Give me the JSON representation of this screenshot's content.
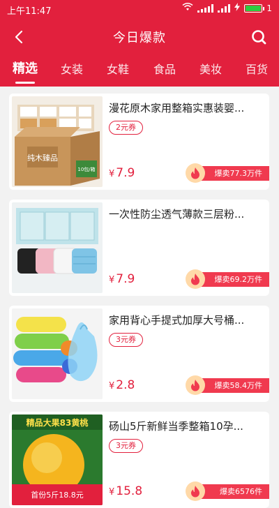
{
  "status_bar": {
    "time": "上午11:47",
    "battery_level": "1"
  },
  "header": {
    "title": "今日爆款"
  },
  "tabs": [
    {
      "label": "精选",
      "active": true
    },
    {
      "label": "女装",
      "active": false
    },
    {
      "label": "女鞋",
      "active": false
    },
    {
      "label": "食品",
      "active": false
    },
    {
      "label": "美妆",
      "active": false
    },
    {
      "label": "百货",
      "active": false
    }
  ],
  "products": [
    {
      "name": "漫花原木家用整箱实惠装婴...",
      "coupon": "2元券",
      "currency": "¥",
      "price": "7.9",
      "sold": "爆卖77.3万件",
      "image": "tissue-box-image",
      "image_text": "纯木臻品",
      "image_badge": "10包/箱"
    },
    {
      "name": "一次性防尘透气薄款三层粉...",
      "coupon": "",
      "currency": "¥",
      "price": "7.9",
      "sold": "爆卖69.2万件",
      "image": "face-masks-image"
    },
    {
      "name": "家用背心手提式加厚大号桶...",
      "coupon": "3元券",
      "currency": "¥",
      "price": "2.8",
      "sold": "爆卖58.4万件",
      "image": "garbage-bags-image"
    },
    {
      "name": "砀山5斤新鲜当季整箱10孕...",
      "coupon": "3元券",
      "currency": "¥",
      "price": "15.8",
      "sold": "爆卖6576件",
      "image": "yellow-peach-image",
      "image_text": "精品大果83黄桃",
      "image_badge": "首份5斤18.8元"
    }
  ],
  "colors": {
    "primary": "#e2203d",
    "sold_pill": "#f03a4f",
    "flame_bg": "#ffd9a8"
  }
}
